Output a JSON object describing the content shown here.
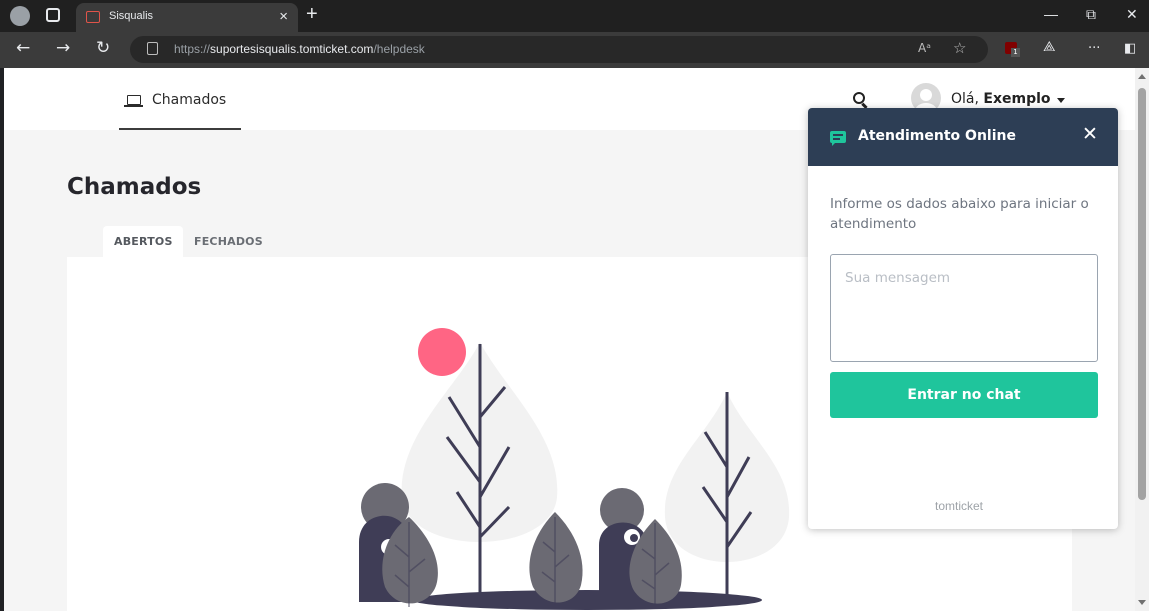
{
  "browser": {
    "tab_title": "Sisqualis",
    "tab_close": "×",
    "new_tab": "+",
    "url_scheme": "https://",
    "url_host": "suportesisqualis.tomticket.com",
    "url_path": "/helpdesk",
    "read_aloud": "Aᵃ",
    "favorite": "☆",
    "more": "···",
    "ublock_count": "1"
  },
  "window": {
    "minimize": "—",
    "maximize": "⧉",
    "close": "✕"
  },
  "nav": {
    "back": "←",
    "forward": "→",
    "reload": "↻"
  },
  "header": {
    "nav_label": "Chamados",
    "greeting_prefix": "Olá, ",
    "user_name": "Exemplo"
  },
  "main": {
    "title": "Chamados",
    "tabs": [
      "ABERTOS",
      "FECHADOS"
    ]
  },
  "chat": {
    "title": "Atendimento Online",
    "close": "✕",
    "intro": "Informe os dados abaixo para iniciar o atendimento",
    "message_placeholder": "Sua mensagem",
    "submit_label": "Entrar no chat",
    "brand": "tomticket"
  },
  "colors": {
    "accent": "#1fc59c",
    "chat_header": "#2d3e55",
    "illustration_sun": "#ff6584",
    "illustration_dark": "#3f3d56"
  }
}
